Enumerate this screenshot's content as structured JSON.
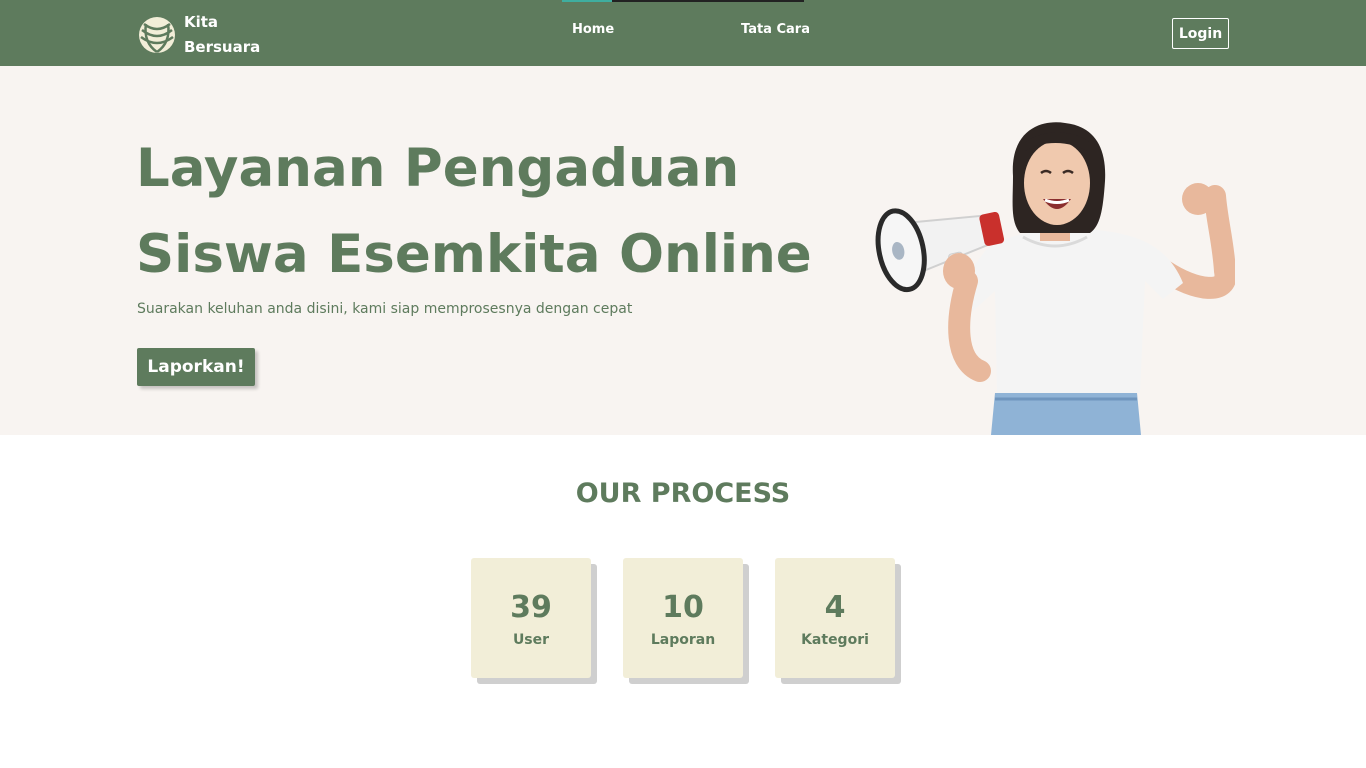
{
  "nav": {
    "brand_line1": "Kita",
    "brand_line2": "Bersuara",
    "links": [
      {
        "label": "Home"
      },
      {
        "label": "Tata Cara"
      }
    ],
    "login_label": "Login"
  },
  "hero": {
    "title_line1": "Layanan Pengaduan",
    "title_line2": "Siswa Esemkita Online",
    "subtitle": "Suarakan keluhan anda disini, kami siap memprosesnya dengan cepat",
    "cta_label": "Laporkan!"
  },
  "process": {
    "title": "OUR PROCESS",
    "stats": [
      {
        "value": "39",
        "label": "User"
      },
      {
        "value": "10",
        "label": "Laporan"
      },
      {
        "value": "4",
        "label": "Kategori"
      }
    ]
  },
  "colors": {
    "primary": "#5e7b5d",
    "hero_bg": "#f8f4f1",
    "card_bg": "#f2eed8",
    "nav_active": "#3fae9f"
  },
  "icons": {
    "logo": "leaf-logo-icon",
    "hero_image": "woman-with-megaphone"
  }
}
